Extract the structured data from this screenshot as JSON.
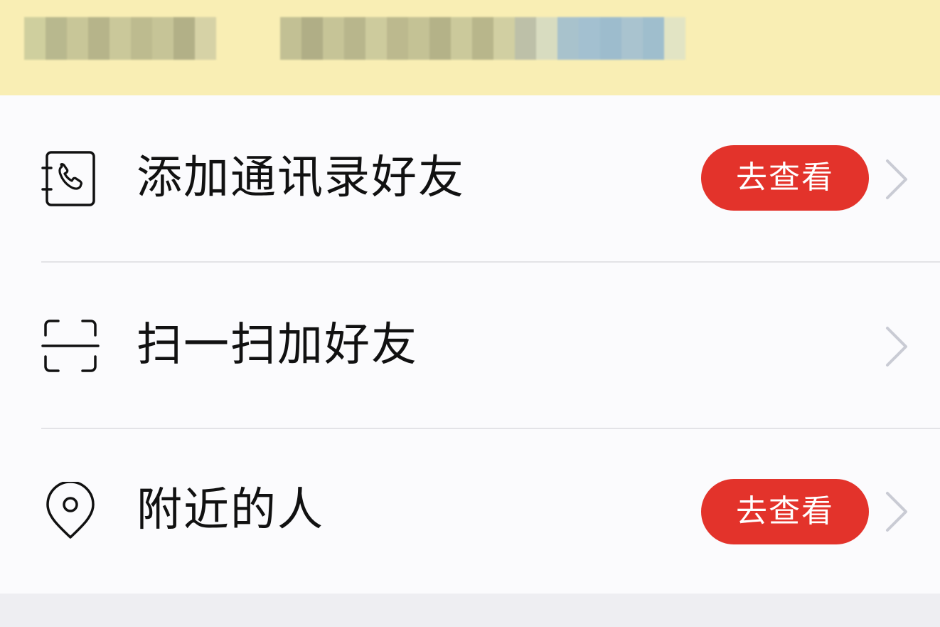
{
  "theme": {
    "badge_color": "#e3332b",
    "banner_color": "#f9eeb4",
    "chevron_color": "#c9cbd4"
  },
  "menu": {
    "items": [
      {
        "label": "添加通讯录好友",
        "icon": "phone-contacts-icon",
        "badge": "去查看"
      },
      {
        "label": "扫一扫加好友",
        "icon": "scan-icon",
        "badge": ""
      },
      {
        "label": "附近的人",
        "icon": "location-pin-icon",
        "badge": "去查看"
      }
    ]
  }
}
